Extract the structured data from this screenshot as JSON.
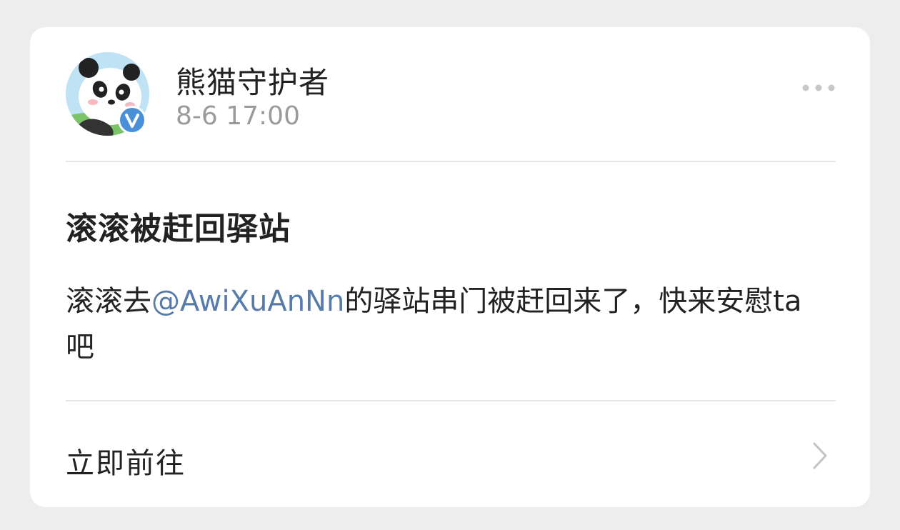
{
  "post": {
    "author": "熊猫守护者",
    "time": "8-6 17:00",
    "title": "滚滚被赶回驿站",
    "body_prefix": "滚滚去",
    "mention": "@AwiXuAnNn",
    "body_suffix": "的驿站串门被赶回来了，快来安慰ta吧",
    "action_label": "立即前往"
  },
  "icons": {
    "avatar": "panda-avatar",
    "verified": "verified-v-badge",
    "more": "more-dots-icon",
    "chevron": "chevron-right-icon"
  },
  "colors": {
    "mention": "#577bab",
    "verified_badge": "#4a90d9",
    "background": "#ededed"
  }
}
